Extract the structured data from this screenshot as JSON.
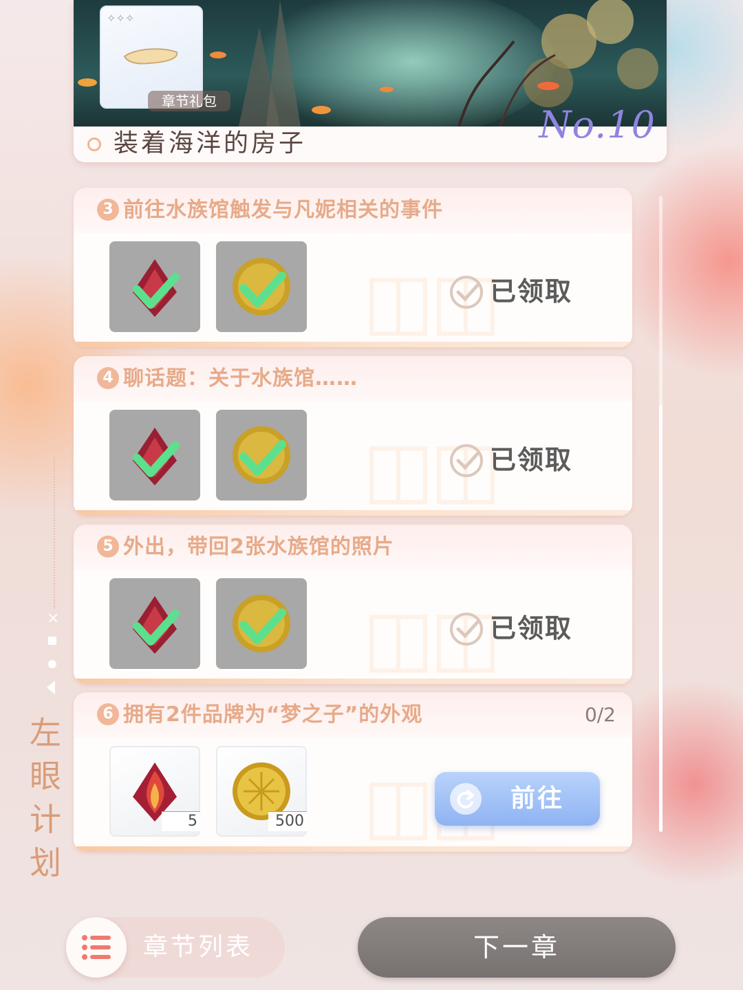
{
  "chapter": {
    "title": "装着海洋的房子",
    "number_label": "No.10",
    "gift_label": "章节礼包"
  },
  "tasks": [
    {
      "num": "3",
      "text": "前往水族馆触发与凡妮相关的事件",
      "status": "已领取",
      "rewards": [
        {
          "icon": "red-crystal-icon",
          "claimed": true
        },
        {
          "icon": "gold-coin-icon",
          "claimed": true
        }
      ]
    },
    {
      "num": "4",
      "text": "聊话题：关于水族馆……",
      "status": "已领取",
      "rewards": [
        {
          "icon": "red-crystal-icon",
          "claimed": true
        },
        {
          "icon": "gold-coin-icon",
          "claimed": true
        }
      ]
    },
    {
      "num": "5",
      "text": "外出，带回2张水族馆的照片",
      "status": "已领取",
      "rewards": [
        {
          "icon": "red-crystal-icon",
          "claimed": true
        },
        {
          "icon": "gold-coin-icon",
          "claimed": true
        }
      ]
    },
    {
      "num": "6",
      "text": "拥有2件品牌为“梦之子”的外观",
      "progress": "0/2",
      "button": "前往",
      "rewards": [
        {
          "icon": "red-crystal-icon",
          "qty": "5"
        },
        {
          "icon": "gold-coin-icon",
          "qty": "500"
        }
      ]
    }
  ],
  "side": {
    "title": "左眼计划"
  },
  "bottom": {
    "chapter_list": "章节列表",
    "next_chapter": "下一章"
  },
  "colors": {
    "accent_orange": "#e7aa89",
    "go_button_blue": "#8fb3f2",
    "chapter_number_purple": "#8f84e0"
  }
}
